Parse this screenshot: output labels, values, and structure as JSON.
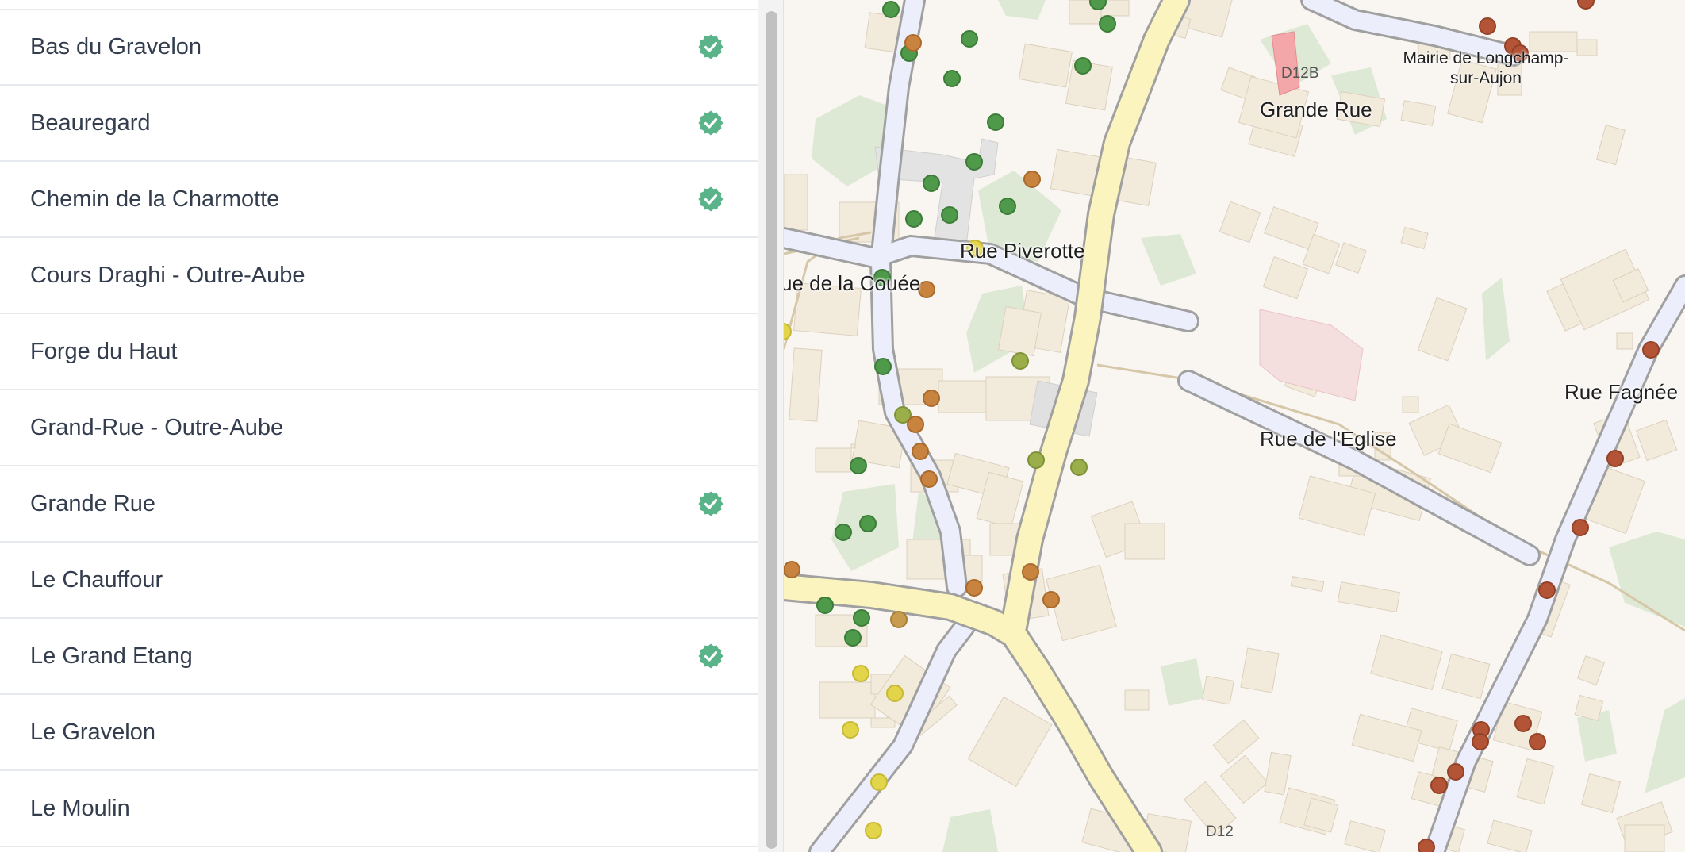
{
  "sidebar": {
    "items": [
      {
        "label": "Bas du Gravelon",
        "checked": true
      },
      {
        "label": "Beauregard",
        "checked": true
      },
      {
        "label": "Chemin de la Charmotte",
        "checked": true
      },
      {
        "label": "Cours Draghi - Outre-Aube",
        "checked": false
      },
      {
        "label": "Forge du Haut",
        "checked": false
      },
      {
        "label": "Grand-Rue - Outre-Aube",
        "checked": false
      },
      {
        "label": "Grande Rue",
        "checked": true
      },
      {
        "label": "Le Chauffour",
        "checked": false
      },
      {
        "label": "Le Grand Etang",
        "checked": true
      },
      {
        "label": "Le Gravelon",
        "checked": false
      },
      {
        "label": "Le Moulin",
        "checked": false
      }
    ],
    "check_icon": "check-badge-icon",
    "check_color": "#5bb38a"
  },
  "map": {
    "labels": {
      "grande_rue": "Grande Rue",
      "rue_piverotte": "Rue Piverotte",
      "rue_couee": "ue de la Couée",
      "rue_eglise": "Rue de l'Eglise",
      "rue_fagnee": "Rue Fagnée",
      "mairie_line1": "Mairie de Longchamp-",
      "mairie_line2": "sur-Aujon",
      "ref_d12b": "D12B",
      "ref_d12": "D12"
    },
    "colors": {
      "background": "#f9f6f2",
      "building": "#f2eadb",
      "green_area": "#dde9d5",
      "main_road": "#fbf4bf",
      "minor_road": "#eceffb",
      "road_casing": "#a0a0a0",
      "track": "#d6c7a8",
      "townhall": "#f4a7a9",
      "church": "#f5dede",
      "dot_green": "#4e9a4a",
      "dot_olive": "#9aaf4a",
      "dot_yellow": "#e3d54a",
      "dot_orange": "#c8833f",
      "dot_red": "#b35436",
      "dot_ochre": "#c89c4f"
    }
  }
}
